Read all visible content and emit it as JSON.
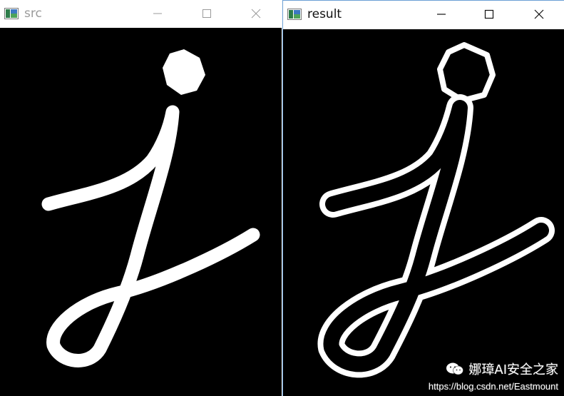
{
  "windows": {
    "src": {
      "title": "src"
    },
    "result": {
      "title": "result"
    }
  },
  "controls": {
    "minimize_icon": "minimize-icon",
    "maximize_icon": "maximize-icon",
    "close_icon": "close-icon"
  },
  "watermark": {
    "brand": "娜璋AI安全之家",
    "url": "https://blog.csdn.net/Eastmount",
    "icon": "wechat-icon"
  },
  "colors": {
    "window_border_active": "#6b9fd4",
    "inactive_title": "#9a9a9a",
    "canvas": "#000000",
    "stroke": "#ffffff"
  }
}
